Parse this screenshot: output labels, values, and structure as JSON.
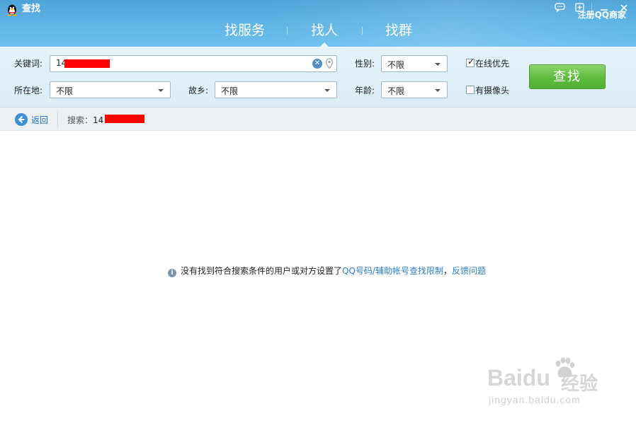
{
  "window": {
    "title": "查找",
    "controls": [
      "chat-icon",
      "add-window-icon",
      "minimize-icon",
      "close-icon"
    ]
  },
  "tabs": [
    {
      "label": "找服务",
      "active": false
    },
    {
      "label": "找人",
      "active": true
    },
    {
      "label": "找群",
      "active": false
    }
  ],
  "register_link": "注册QQ商家",
  "form": {
    "keyword_label": "关键词:",
    "keyword_value": "14",
    "gender_label": "性别:",
    "gender_value": "不限",
    "location_label": "所在地:",
    "location_value": "不限",
    "hometown_label": "故乡:",
    "hometown_value": "不限",
    "age_label": "年龄:",
    "age_value": "不限",
    "online_first_label": "在线优先",
    "online_first_checked": true,
    "has_camera_label": "有摄像头",
    "has_camera_checked": false,
    "search_button": "查找"
  },
  "nav": {
    "back_label": "返回",
    "search_prefix": "搜索：",
    "search_value": "14"
  },
  "result": {
    "message": "没有找到符合搜索条件的用户或对方设置了",
    "link1": "QQ号码/辅助帐号查找限制",
    "separator": "，",
    "link2": "反馈问题"
  },
  "watermark": {
    "brand": "Baidu",
    "brand_cn": "经验",
    "url": "jingyan.baidu.com"
  },
  "colors": {
    "header": "#5cb3e4",
    "panel": "#e3f1fa",
    "search_button": "#5fbb3e",
    "link": "#2a7dc9",
    "redaction": "#ff0000"
  }
}
